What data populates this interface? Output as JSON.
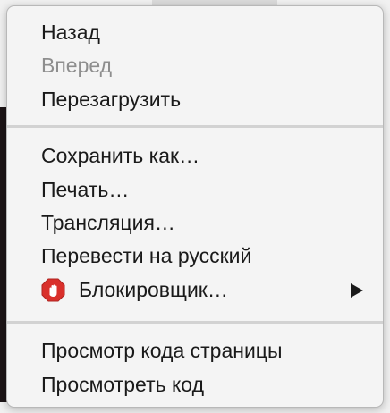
{
  "menu": {
    "groups": [
      [
        {
          "label": "Назад",
          "enabled": true
        },
        {
          "label": "Вперед",
          "enabled": false
        },
        {
          "label": "Перезагрузить",
          "enabled": true
        }
      ],
      [
        {
          "label": "Сохранить как…",
          "enabled": true
        },
        {
          "label": "Печать…",
          "enabled": true
        },
        {
          "label": "Трансляция…",
          "enabled": true
        },
        {
          "label": "Перевести на русский",
          "enabled": true
        },
        {
          "label": "Блокировщик…",
          "enabled": true,
          "icon": "adblock-hand-icon",
          "submenu": true
        }
      ],
      [
        {
          "label": "Просмотр кода страницы",
          "enabled": true
        },
        {
          "label": "Просмотреть код",
          "enabled": true
        }
      ]
    ]
  },
  "colors": {
    "menu_bg": "#f4f4f4",
    "text": "#1a1a1a",
    "disabled_text": "#8e8e8e",
    "separator": "#d2d2d2",
    "adblock_red": "#d9302b"
  }
}
